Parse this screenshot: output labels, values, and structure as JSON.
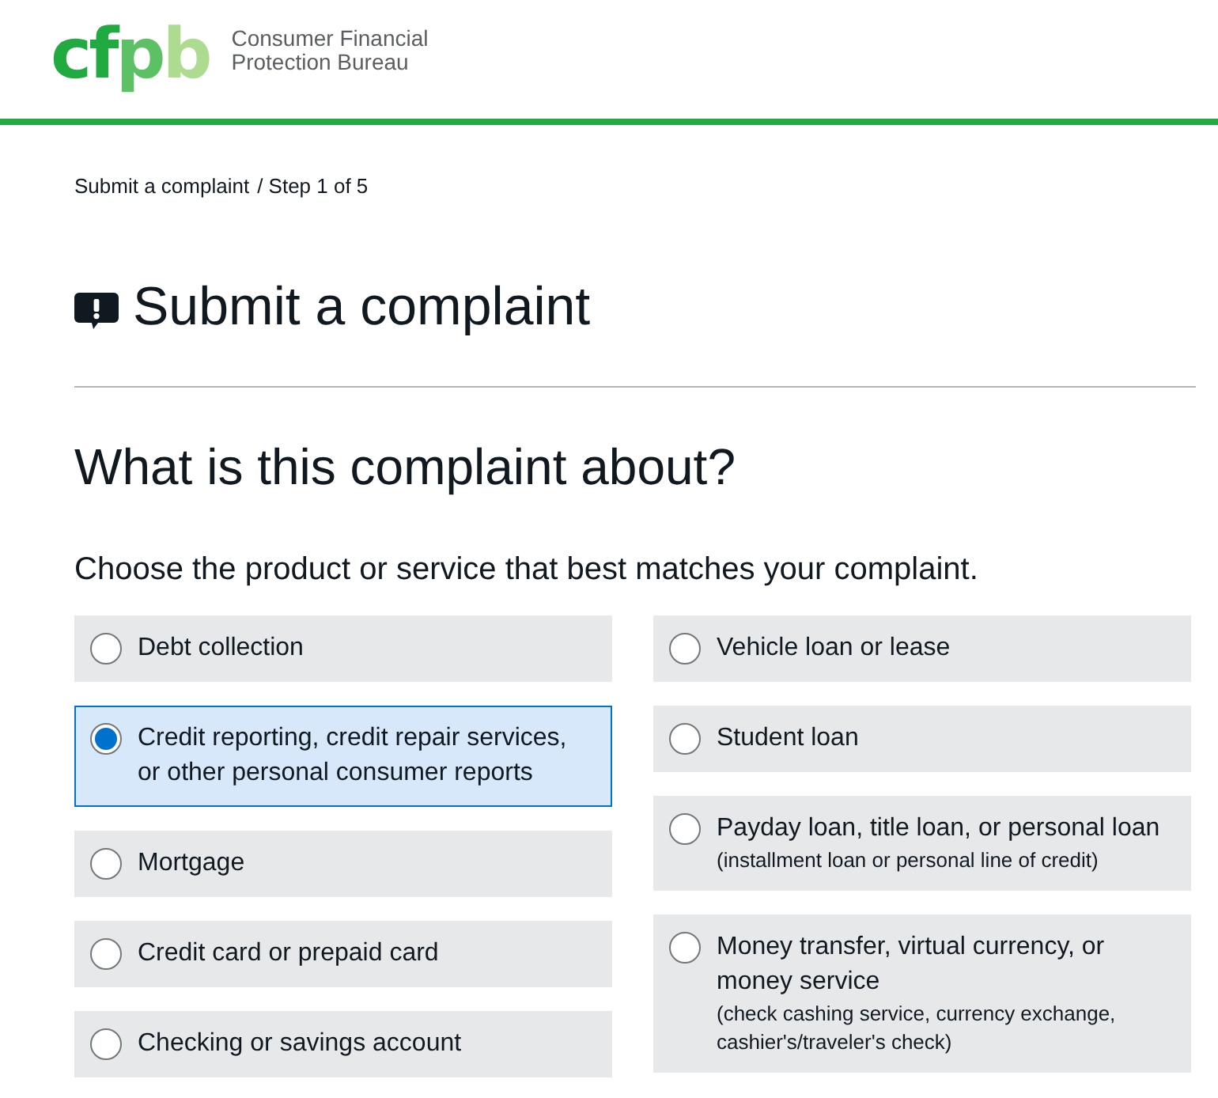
{
  "header": {
    "logo": "cfpb",
    "agency_name": "Consumer Financial Protection Bureau"
  },
  "breadcrumb": {
    "link": "Submit a complaint",
    "current": "/ Step 1 of 5"
  },
  "page_title": "Submit a complaint",
  "question": "What is this complaint about?",
  "instruction": "Choose the product or service that best matches your complaint.",
  "columns": [
    {
      "options": [
        {
          "label": "Debt collection",
          "selected": false
        },
        {
          "label": "Credit reporting, credit repair services, or other personal consumer reports",
          "selected": true
        },
        {
          "label": "Mortgage",
          "selected": false
        },
        {
          "label": "Credit card or prepaid card",
          "selected": false
        },
        {
          "label": "Checking or savings account",
          "selected": false
        }
      ]
    },
    {
      "options": [
        {
          "label": "Vehicle loan or lease",
          "selected": false
        },
        {
          "label": "Student loan",
          "selected": false
        },
        {
          "label": "Payday loan, title loan, or personal loan",
          "detail": "(installment loan or personal line of credit)",
          "selected": false
        },
        {
          "label": "Money transfer, virtual currency, or money service",
          "detail": "(check cashing service, currency exchange, cashier's/traveler's check)",
          "selected": false
        }
      ]
    }
  ]
}
